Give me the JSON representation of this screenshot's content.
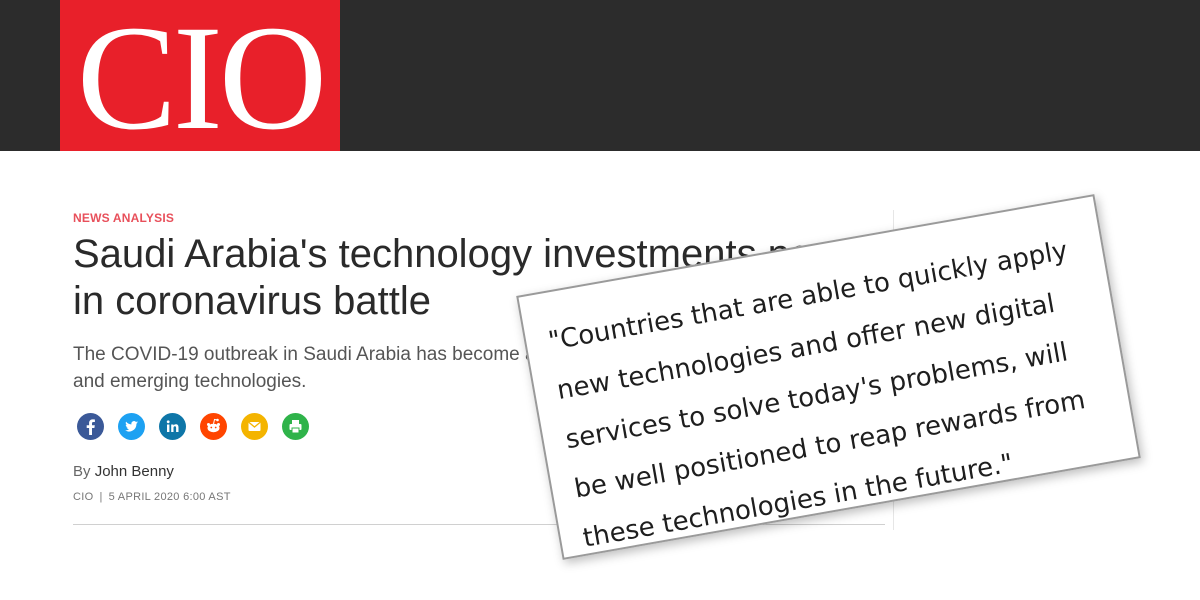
{
  "header": {
    "logo_text": "CIO",
    "background_color": "#2c2c2c",
    "logo_color": "#e8202a"
  },
  "article": {
    "kicker": "NEWS ANALYSIS",
    "headline": "Saudi Arabia's technology investments pay off in coronavirus battle",
    "dek": "The COVID-19 outbreak in Saudi Arabia has become a test of mobile apps, government portals, and emerging technologies.",
    "byline_prefix": "By",
    "author": "John Benny",
    "publication": "CIO",
    "date": "5 APRIL 2020 6:00 AST"
  },
  "share": {
    "icons": [
      {
        "name": "facebook-icon",
        "color": "#3b5998"
      },
      {
        "name": "twitter-icon",
        "color": "#1da1f2"
      },
      {
        "name": "linkedin-icon",
        "color": "#0e76a8"
      },
      {
        "name": "reddit-icon",
        "color": "#ff4500"
      },
      {
        "name": "email-icon",
        "color": "#f4b400"
      },
      {
        "name": "print-icon",
        "color": "#2fb34a"
      }
    ]
  },
  "quote": {
    "text": "\"Countries that are able to quickly apply new technologies and offer new digital services to solve today's problems, will be well positioned to reap rewards from these technologies in the future.\""
  }
}
